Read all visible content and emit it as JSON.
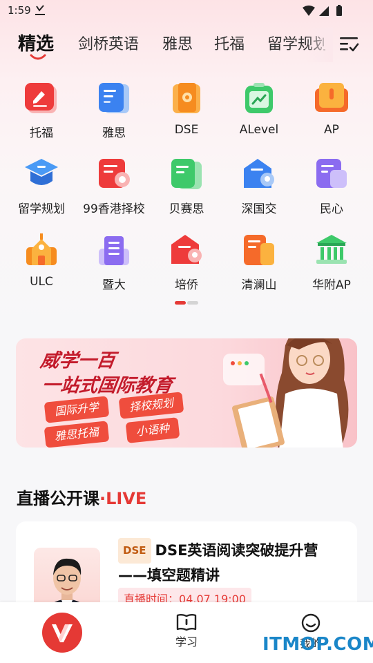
{
  "status_bar": {
    "time": "1:59"
  },
  "tabs": {
    "items": [
      {
        "label": "精选"
      },
      {
        "label": "剑桥英语"
      },
      {
        "label": "雅思"
      },
      {
        "label": "托福"
      },
      {
        "label": "留学规划"
      }
    ]
  },
  "grid": {
    "items": [
      {
        "label": "托福",
        "icon": "toefl-icon"
      },
      {
        "label": "雅思",
        "icon": "ielts-icon"
      },
      {
        "label": "DSE",
        "icon": "dse-icon"
      },
      {
        "label": "ALevel",
        "icon": "alevel-icon"
      },
      {
        "label": "AP",
        "icon": "ap-icon"
      },
      {
        "label": "留学规划",
        "icon": "study-abroad-icon"
      },
      {
        "label": "99香港择校",
        "icon": "hk-school-icon"
      },
      {
        "label": "贝赛思",
        "icon": "basis-icon"
      },
      {
        "label": "深国交",
        "icon": "shenguojiao-icon"
      },
      {
        "label": "民心",
        "icon": "minxin-icon"
      },
      {
        "label": "ULC",
        "icon": "ulc-icon"
      },
      {
        "label": "暨大",
        "icon": "jinan-univ-icon"
      },
      {
        "label": "培侨",
        "icon": "peiqiao-icon"
      },
      {
        "label": "清澜山",
        "icon": "qinglanshan-icon"
      },
      {
        "label": "华附AP",
        "icon": "huafu-ap-icon"
      }
    ]
  },
  "banner": {
    "title_line1": "威学一百",
    "title_line2": "一站式国际教育",
    "pills": [
      "国际升学",
      "择校规划",
      "雅思托福",
      "小语种"
    ]
  },
  "live_section": {
    "title": "直播公开课",
    "separator": "·",
    "live_label": "LIVE",
    "course": {
      "tag": "DSE",
      "title": "DSE英语阅读突破提升营 ——填空题精讲",
      "time_label": "直播时间：",
      "time_value": "04.07 19:00"
    }
  },
  "bottom_nav": {
    "items": [
      {
        "label": "学习"
      },
      {
        "label": "我的"
      }
    ]
  },
  "watermark": "ITMOP.COM",
  "colors": {
    "accent": "#e53935",
    "banner_pill": "#ef4d3d",
    "watermark": "#1a86c8"
  }
}
